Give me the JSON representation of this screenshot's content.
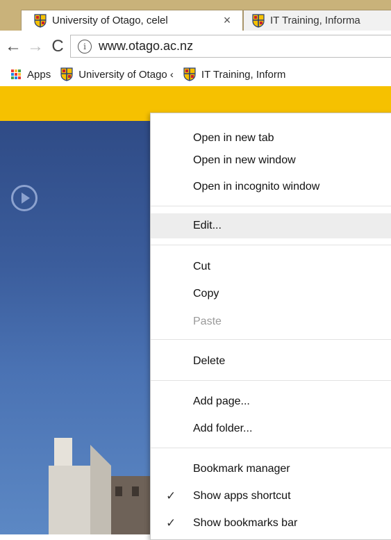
{
  "tabs": [
    {
      "title": "University of Otago, celel",
      "active": true,
      "close": "×"
    },
    {
      "title": "IT Training, Informa",
      "active": false
    }
  ],
  "toolbar": {
    "back": "←",
    "forward": "→",
    "reload": "C",
    "info": "i",
    "url": "www.otago.ac.nz"
  },
  "bookmarks": {
    "apps": "Apps",
    "items": [
      "University of Otago ‹",
      "IT Training, Inform"
    ]
  },
  "context_menu": {
    "open_new_tab": "Open in new tab",
    "open_new_window": "Open in new window",
    "open_incognito": "Open in incognito window",
    "edit": "Edit...",
    "cut": "Cut",
    "copy": "Copy",
    "paste": "Paste",
    "delete": "Delete",
    "add_page": "Add page...",
    "add_folder": "Add folder...",
    "bookmark_manager": "Bookmark manager",
    "show_apps_shortcut": "Show apps shortcut",
    "show_bookmarks_bar": "Show bookmarks bar",
    "checkmark": "✓"
  },
  "colors": {
    "otago_yellow": "#f6c100",
    "menu_hover": "#ededed",
    "disabled_text": "#9a9a9a"
  }
}
